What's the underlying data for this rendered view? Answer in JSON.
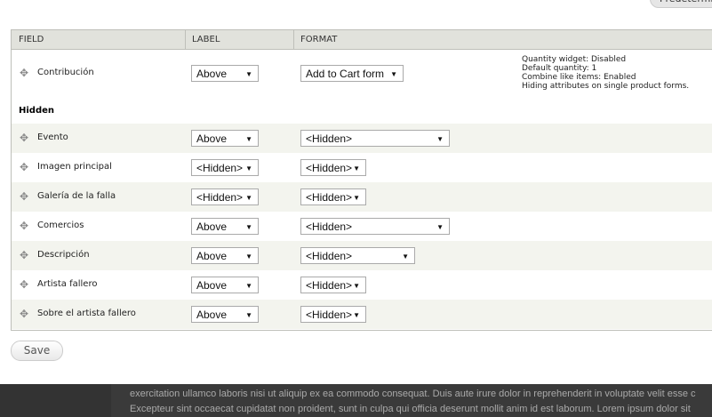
{
  "top_button": "Predetermina",
  "table": {
    "headers": [
      "FIELD",
      "LABEL",
      "FORMAT"
    ]
  },
  "visible_row": {
    "name": "Contribución",
    "label": "Above",
    "format": "Add to Cart form",
    "summary": [
      "Quantity widget: Disabled",
      "Default quantity: 1",
      "Combine like items: Enabled",
      "Hiding attributes on single product forms."
    ]
  },
  "hidden_section": "Hidden",
  "hidden_rows": [
    {
      "name": "Evento",
      "label": "Above",
      "format": "<Hidden>"
    },
    {
      "name": "Imagen principal",
      "label": "<Hidden>",
      "format": "<Hidden>"
    },
    {
      "name": "Galería de la falla",
      "label": "<Hidden>",
      "format": "<Hidden>"
    },
    {
      "name": "Comercios",
      "label": "Above",
      "format": "<Hidden>"
    },
    {
      "name": "Descripción",
      "label": "Above",
      "format": "<Hidden>"
    },
    {
      "name": "Artista fallero",
      "label": "Above",
      "format": "<Hidden>"
    },
    {
      "name": "Sobre el artista fallero",
      "label": "Above",
      "format": "<Hidden>"
    }
  ],
  "save_label": "Save",
  "footer_lines": [
    "exercitation ullamco laboris nisi ut aliquip ex ea commodo consequat. Duis aute irure dolor in reprehenderit in voluptate velit esse c",
    "Excepteur sint occaecat cupidatat non proident, sunt in culpa qui officia deserunt mollit anim id est laborum. Lorem ipsum dolor sit"
  ]
}
